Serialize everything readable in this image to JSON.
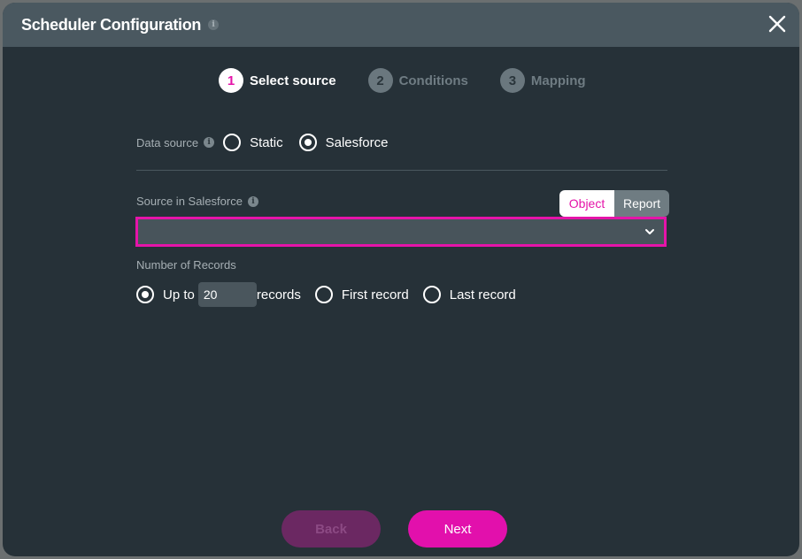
{
  "window": {
    "title": "Scheduler Configuration",
    "title_info_icon": "info-icon"
  },
  "steps": [
    {
      "num": "1",
      "label": "Select source",
      "active": true
    },
    {
      "num": "2",
      "label": "Conditions",
      "active": false
    },
    {
      "num": "3",
      "label": "Mapping",
      "active": false
    }
  ],
  "data_source": {
    "label": "Data source",
    "options": [
      {
        "label": "Static",
        "selected": false
      },
      {
        "label": "Salesforce",
        "selected": true
      }
    ]
  },
  "source_in_salesforce": {
    "label": "Source in Salesforce",
    "toggle": {
      "options": [
        "Object",
        "Report"
      ],
      "selected": "Object"
    },
    "select_value": ""
  },
  "records": {
    "label": "Number of Records",
    "up_to_label": "Up to",
    "up_to_value": "20",
    "records_suffix": "records",
    "first_label": "First record",
    "last_label": "Last record",
    "selected": "up_to"
  },
  "buttons": {
    "back": "Back",
    "next": "Next"
  },
  "colors": {
    "accent": "#e514a9",
    "background": "#263138",
    "header": "#4a5860"
  }
}
